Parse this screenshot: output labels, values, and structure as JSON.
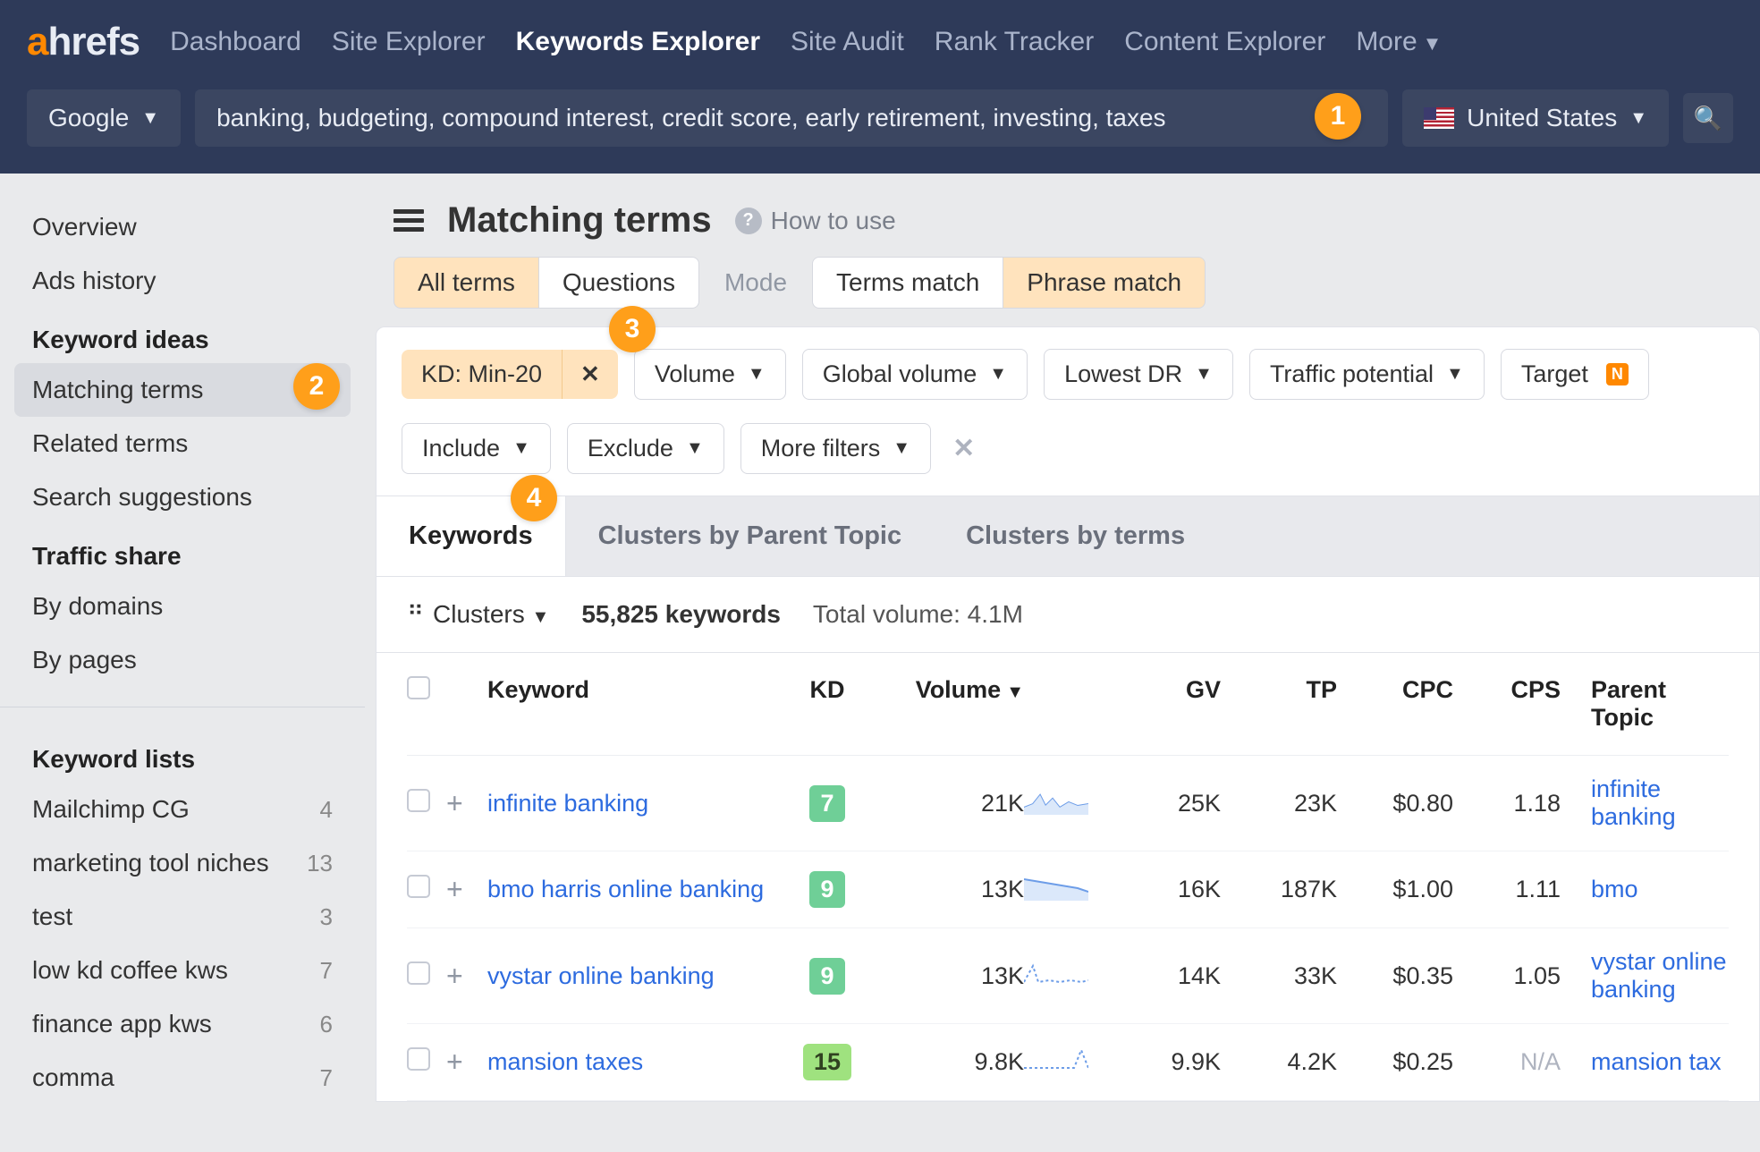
{
  "brand": {
    "a": "a",
    "hrefs": "hrefs"
  },
  "nav": {
    "dashboard": "Dashboard",
    "site_explorer": "Site Explorer",
    "keywords_explorer": "Keywords Explorer",
    "site_audit": "Site Audit",
    "rank_tracker": "Rank Tracker",
    "content_explorer": "Content Explorer",
    "more": "More"
  },
  "search": {
    "engine": "Google",
    "keywords": "banking, budgeting, compound interest, credit score, early retirement, investing, taxes",
    "country": "United States"
  },
  "annotations": {
    "one": "1",
    "two": "2",
    "three": "3",
    "four": "4"
  },
  "sidebar": {
    "overview": "Overview",
    "ads_history": "Ads history",
    "keyword_ideas_head": "Keyword ideas",
    "matching_terms": "Matching terms",
    "related_terms": "Related terms",
    "search_suggestions": "Search suggestions",
    "traffic_share_head": "Traffic share",
    "by_domains": "By domains",
    "by_pages": "By pages",
    "keyword_lists_head": "Keyword lists",
    "lists": [
      {
        "name": "Mailchimp CG",
        "count": "4"
      },
      {
        "name": "marketing tool niches",
        "count": "13"
      },
      {
        "name": "test",
        "count": "3"
      },
      {
        "name": "low kd coffee kws",
        "count": "7"
      },
      {
        "name": "finance app kws",
        "count": "6"
      },
      {
        "name": "comma",
        "count": "7"
      }
    ]
  },
  "page": {
    "title": "Matching terms",
    "how_to_use": "How to use"
  },
  "segTabs": {
    "all_terms": "All terms",
    "questions": "Questions",
    "mode": "Mode",
    "terms_match": "Terms match",
    "phrase_match": "Phrase match"
  },
  "filters": {
    "kd": "KD: Min-20",
    "volume": "Volume",
    "global_volume": "Global volume",
    "lowest_dr": "Lowest DR",
    "traffic_potential": "Traffic potential",
    "target": "Target",
    "new_badge": "N",
    "include": "Include",
    "exclude": "Exclude",
    "more_filters": "More filters"
  },
  "subtabs": {
    "keywords": "Keywords",
    "clusters_parent": "Clusters by Parent Topic",
    "clusters_terms": "Clusters by terms"
  },
  "summary": {
    "clusters": "Clusters",
    "keyword_count": "55,825 keywords",
    "total_volume": "Total volume: 4.1M"
  },
  "table": {
    "headers": {
      "keyword": "Keyword",
      "kd": "KD",
      "volume": "Volume",
      "gv": "GV",
      "tp": "TP",
      "cpc": "CPC",
      "cps": "CPS",
      "parent_topic": "Parent Topic"
    },
    "rows": [
      {
        "keyword": "infinite banking",
        "kd": "7",
        "kd_class": "kd-green",
        "volume": "21K",
        "gv": "25K",
        "tp": "23K",
        "cpc": "$0.80",
        "cps": "1.18",
        "parent": "infinite banking"
      },
      {
        "keyword": "bmo harris online banking",
        "kd": "9",
        "kd_class": "kd-green",
        "volume": "13K",
        "gv": "16K",
        "tp": "187K",
        "cpc": "$1.00",
        "cps": "1.11",
        "parent": "bmo"
      },
      {
        "keyword": "vystar online banking",
        "kd": "9",
        "kd_class": "kd-green",
        "volume": "13K",
        "gv": "14K",
        "tp": "33K",
        "cpc": "$0.35",
        "cps": "1.05",
        "parent": "vystar online banking"
      },
      {
        "keyword": "mansion taxes",
        "kd": "15",
        "kd_class": "kd-lime",
        "volume": "9.8K",
        "gv": "9.9K",
        "tp": "4.2K",
        "cpc": "$0.25",
        "cps": "N/A",
        "parent": "mansion tax"
      }
    ]
  }
}
